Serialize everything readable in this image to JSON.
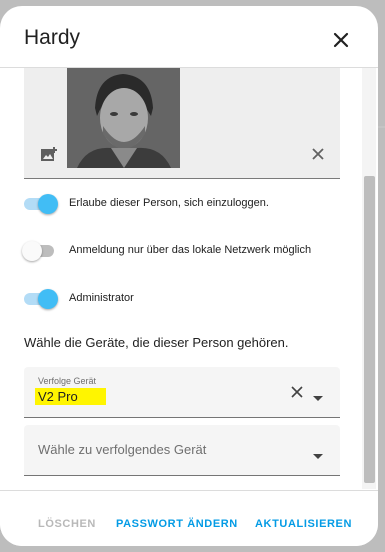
{
  "dialog": {
    "title": "Hardy"
  },
  "picture": {
    "alt": "Profilbild"
  },
  "toggles": [
    {
      "label": "Erlaube dieser Person, sich einzuloggen.",
      "on": true
    },
    {
      "label": "Anmeldung nur über das lokale Netzwerk möglich",
      "on": false
    },
    {
      "label": "Administrator",
      "on": true
    }
  ],
  "devices": {
    "heading": "Wähle die Geräte, die dieser Person gehören.",
    "tracked": {
      "label": "Verfolge Gerät",
      "value": "V2 Pro"
    },
    "add": {
      "placeholder": "Wähle zu verfolgendes Gerät"
    }
  },
  "footer": {
    "delete_label": "LÖSCHEN",
    "password_label": "PASSWORT ÄNDERN",
    "update_label": "AKTUALISIEREN"
  },
  "colors": {
    "accent": "#03a9f4",
    "toggle_on_knob": "#41bdf5",
    "toggle_on_track": "#b3dcf6",
    "highlight": "#fff500"
  },
  "icons": {
    "close": "close-icon",
    "add_photo": "add-photo-icon",
    "clear": "clear-icon",
    "dropdown": "chevron-down-icon"
  }
}
